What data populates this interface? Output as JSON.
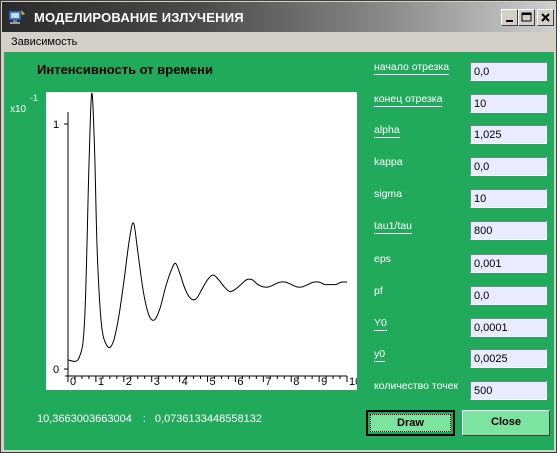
{
  "window": {
    "title": "МОДЕЛИРОВАНИЕ ИЗЛУЧЕНИЯ"
  },
  "menu": {
    "items": [
      "Зависимость"
    ]
  },
  "chart": {
    "title": "Интенсивность от времени",
    "scale_label": "x10",
    "scale_exp": "-1"
  },
  "params": [
    {
      "label": "начало отрезка",
      "value": "0,0"
    },
    {
      "label": "конец отрезка",
      "value": "10"
    },
    {
      "label": "alpha",
      "value": "1,025"
    },
    {
      "label": "kappa",
      "value": "0,0"
    },
    {
      "label": "sigma",
      "value": "10"
    },
    {
      "label": "tau1/tau",
      "value": "800"
    },
    {
      "label": "eps",
      "value": "0,001"
    },
    {
      "label": "pf",
      "value": "0,0"
    },
    {
      "label": "Y0",
      "value": "0,0001"
    },
    {
      "label": "y0",
      "value": "0,0025"
    },
    {
      "label": "количество точек",
      "value": "500"
    }
  ],
  "status": {
    "x": "10,3663003663004",
    "sep": ":",
    "y": "0,0736133448558132"
  },
  "buttons": {
    "draw": "Draw",
    "close": "Close"
  },
  "colors": {
    "panel": "#22aa5c",
    "button": "#7de3a0",
    "input": "#e8ecff"
  },
  "chart_data": {
    "type": "line",
    "title": "Интенсивность от времени",
    "xlabel": "",
    "ylabel": "",
    "xlim": [
      0,
      10
    ],
    "ylim": [
      0,
      1
    ],
    "x_ticks": [
      "0",
      "1",
      "2",
      "3",
      "4",
      "5",
      "6",
      "7",
      "8",
      "9",
      "10"
    ],
    "y_ticks": [
      "0",
      "1"
    ],
    "series": [
      {
        "x": [
          0,
          0.4,
          0.6,
          0.75,
          0.85,
          0.95,
          1.05,
          1.2,
          1.4,
          1.6,
          1.8,
          2.0,
          2.2,
          2.35,
          2.5,
          2.7,
          2.9,
          3.1,
          3.3,
          3.5,
          3.7,
          3.85,
          4.0,
          4.2,
          4.4,
          4.6,
          4.8,
          5.0,
          5.2,
          5.4,
          5.6,
          5.8,
          6.0,
          6.2,
          6.4,
          6.6,
          6.8,
          7.0,
          7.2,
          7.4,
          7.6,
          7.8,
          8.0,
          8.2,
          8.4,
          8.6,
          8.8,
          9.0,
          9.2,
          9.4,
          9.6,
          9.8,
          10.0
        ],
        "y": [
          0.0,
          0.01,
          0.18,
          0.82,
          1.13,
          0.9,
          0.45,
          0.15,
          0.06,
          0.07,
          0.17,
          0.33,
          0.51,
          0.58,
          0.46,
          0.29,
          0.19,
          0.17,
          0.22,
          0.31,
          0.38,
          0.41,
          0.37,
          0.3,
          0.26,
          0.26,
          0.3,
          0.34,
          0.36,
          0.34,
          0.31,
          0.29,
          0.3,
          0.32,
          0.34,
          0.34,
          0.32,
          0.31,
          0.31,
          0.32,
          0.33,
          0.33,
          0.32,
          0.31,
          0.31,
          0.32,
          0.33,
          0.33,
          0.32,
          0.32,
          0.32,
          0.33,
          0.33
        ]
      }
    ]
  }
}
